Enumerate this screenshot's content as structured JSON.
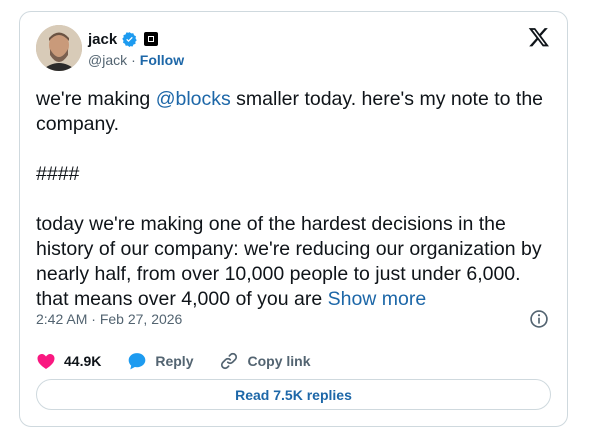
{
  "author": {
    "display_name": "jack",
    "handle": "@jack",
    "separator": "·",
    "follow_label": "Follow"
  },
  "tweet": {
    "text_before_mention": "we're making ",
    "mention": "@blocks",
    "text_after_mention": " smaller today. here's my note to the company.",
    "divider": "####",
    "body": "today we're making one of the hardest decisions in the history of our company: we're reducing our organization by nearly half, from over 10,000 people to just under 6,000. that means over 4,000 of you are ",
    "show_more_label": "Show more"
  },
  "timestamp": {
    "time": "2:42 AM",
    "separator": "·",
    "date": "Feb 27, 2026"
  },
  "actions": {
    "like_count": "44.9K",
    "reply_label": "Reply",
    "copy_link_label": "Copy link"
  },
  "replies_button_label": "Read 7.5K replies",
  "colors": {
    "accent": "#1d67a8",
    "like": "#f91880",
    "reply_icon": "#1d9bf0",
    "verified": "#1d9bf0",
    "text": "#0f1419",
    "secondary": "#536471",
    "border": "#cfd9de"
  },
  "icons": [
    "verified-badge-icon",
    "affiliate-badge-icon",
    "x-logo-icon",
    "info-icon",
    "heart-icon",
    "reply-bubble-icon",
    "link-icon"
  ]
}
